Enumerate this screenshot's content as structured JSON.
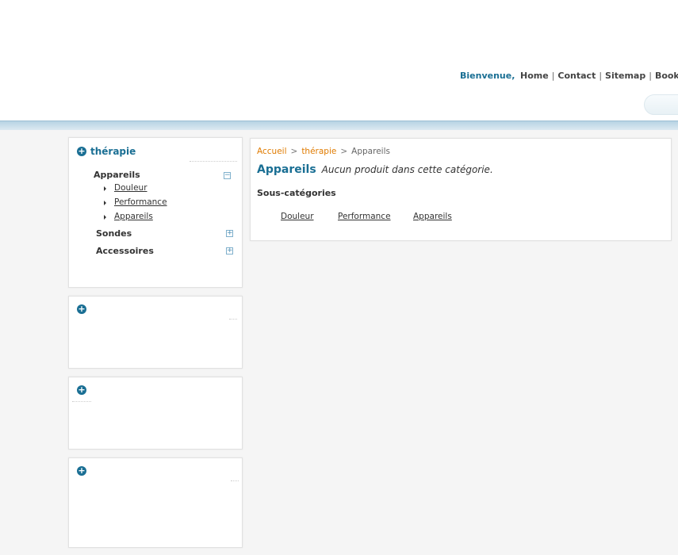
{
  "header": {
    "welcome": "Bienvenue,",
    "nav": [
      "Home",
      "Contact",
      "Sitemap",
      "Bookmark"
    ]
  },
  "sidebar": {
    "category_title": "thérapie",
    "categories": [
      {
        "label": "Appareils",
        "toggle": "−",
        "expanded": true,
        "children": [
          "Douleur",
          "Performance",
          "Appareils"
        ]
      },
      {
        "label": "Sondes",
        "toggle": "+",
        "expanded": false
      },
      {
        "label": "Accessoires",
        "toggle": "+",
        "expanded": false
      }
    ]
  },
  "main": {
    "breadcrumb": {
      "home": "Accueil",
      "separator": ">",
      "parent": "thérapie",
      "current": "Appareils"
    },
    "title": "Appareils",
    "empty_message": "Aucun produit dans cette catégorie.",
    "subcategories_heading": "Sous-catégories",
    "subcategories": [
      "Douleur",
      "Performance",
      "Appareils"
    ]
  },
  "colors": {
    "accent": "#1a6f94",
    "link": "#e07b00",
    "band": "#b7d3e3"
  }
}
